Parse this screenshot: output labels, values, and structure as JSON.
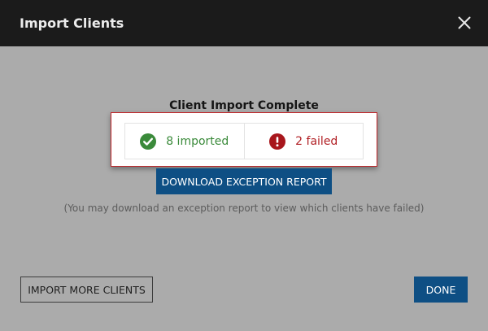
{
  "dialog": {
    "title": "Import Clients",
    "close_icon": "close-icon"
  },
  "result": {
    "title": "Client Import Complete",
    "imported_count": 8,
    "imported_label": "8 imported",
    "imported_icon": "check-circle-icon",
    "failed_count": 2,
    "failed_label": "2 failed",
    "failed_icon": "exclamation-circle-icon"
  },
  "actions": {
    "download_label": "DOWNLOAD EXCEPTION REPORT",
    "note": "(You may download an exception report to view which clients have failed)",
    "import_more_label": "IMPORT MORE CLIENTS",
    "done_label": "DONE"
  },
  "colors": {
    "header_bg": "#1b1b1b",
    "body_bg": "#ababab",
    "primary": "#0e4f84",
    "success": "#3a8a3a",
    "danger": "#b11f24",
    "highlight_border": "#c0262a"
  }
}
